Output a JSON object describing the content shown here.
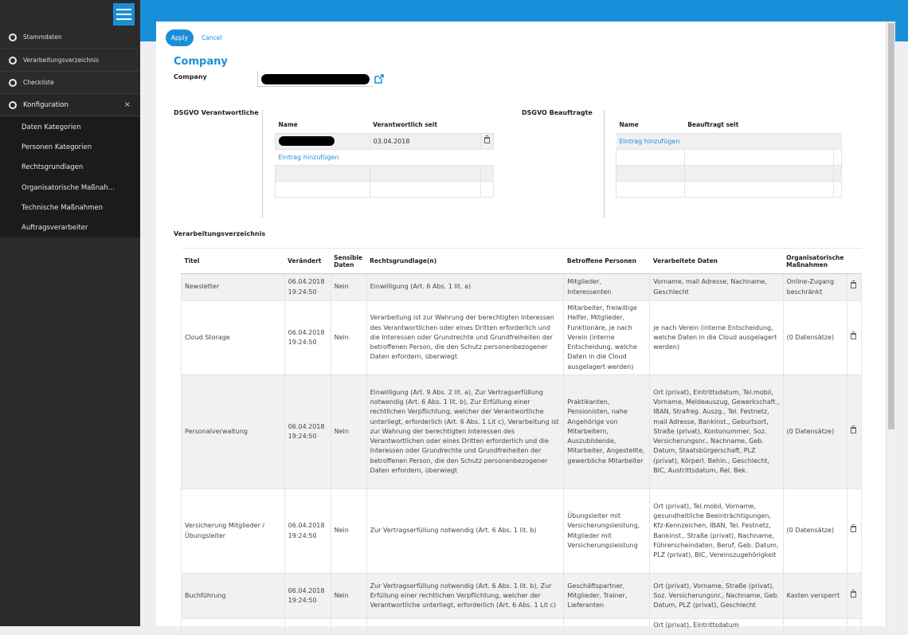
{
  "sidebar": {
    "main_items": [
      {
        "label": "Stammdaten"
      },
      {
        "label": "Verarbeitungsverzeichnis"
      },
      {
        "label": "Checkliste"
      },
      {
        "label": "Konfiguration",
        "close_symbol": "×"
      }
    ],
    "sub_items": [
      {
        "label": "Daten Kategorien"
      },
      {
        "label": "Personen Kategorien"
      },
      {
        "label": "Rechtsgrundlagen"
      },
      {
        "label": "Organisatorische Maßnah..."
      },
      {
        "label": "Technische Maßnahmen"
      },
      {
        "label": "Auftragsverarbeiter"
      }
    ]
  },
  "toolbar": {
    "apply_label": "Apply",
    "cancel_label": "Cancel"
  },
  "company": {
    "heading": "Company",
    "field_label": "Company"
  },
  "verantwortliche": {
    "section_label": "DSGVO Verantwortliche",
    "col_name": "Name",
    "col_since": "Verantwortlich seit",
    "rows": [
      {
        "since": "03.04.2018"
      }
    ],
    "add_link": "Eintrag hinzufügen"
  },
  "beauftragte": {
    "section_label": "DSGVO Beauftragte",
    "col_name": "Name",
    "col_since": "Beauftragt seit",
    "add_link": "Eintrag hinzufügen"
  },
  "verzeichnis": {
    "section_label": "Verarbeitungsverzeichnis",
    "headers": {
      "titel": "Titel",
      "veraendert": "Verändert",
      "sensible": "Sensible Daten",
      "rechtsgrundlage": "Rechtsgrundlage(n)",
      "personen": "Betroffene Personen",
      "daten": "Verarbeitete Daten",
      "massnahmen": "Organisatorische Maßnahmen"
    },
    "rows": [
      {
        "titel": "Newsletter",
        "veraendert": "06.04.2018 19:24:50",
        "sensible": "Nein",
        "rechtsgrundlage": "Einwilligung (Art. 6 Abs. 1 lit. a)",
        "personen": "Mitglieder, Interessenten",
        "daten": "Vorname, mail Adresse, Nachname, Geschlecht",
        "massnahmen": "Online-Zugang beschränkt"
      },
      {
        "titel": "Cloud Storage",
        "veraendert": "06.04.2018 19:24:50",
        "sensible": "Nein",
        "rechtsgrundlage": "Verarbeitung ist zur Wahrung der berechtigten Interessen des Verantwortlichen oder eines Dritten erforderlich und die Interessen oder Grundrechte und Grundfreiheiten der betroffenen Person, die den Schutz personenbezogener Daten erfordern, überwiegt",
        "personen": "Mitarbeiter, freiwillige Helfer, Mitglieder, Funktionäre, je nach Verein (interne Entscheidung, welche Daten in die Cloud ausgelagert werden)",
        "daten": "je nach Verein (interne Entscheidung, welche Daten in die Cloud ausgelagert werden)",
        "massnahmen": "(0 Datensätze)"
      },
      {
        "titel": "Personalverwaltung",
        "veraendert": "06.04.2018 19:24:50",
        "sensible": "Nein",
        "rechtsgrundlage": "Einwilligung (Art. 9 Abs. 2 lit. a), Zur Vertragserfüllung notwendig (Art. 6 Abs. 1 lit. b), Zur Erfüllung einer rechtlichen Verpflichtung, welcher der Verantwortliche unterliegt, erforderlich (Art. 6 Abs. 1 Lit c), Verarbeitung ist zur Wahrung der berechtigten Interessen des Verantwortlichen oder eines Dritten erforderlich und die Interessen oder Grundrechte und Grundfreiheiten der betroffenen Person, die den Schutz personenbezogener Daten erfordern, überwiegt",
        "personen": "Praktikanten, Pensionisten, nahe Angehörige von Mitarbeitern, Auszubildende, Mitarbeiter, Angestellte, gewerbliche Mitarbeiter",
        "daten": "Ort (privat), Eintrittsdatum, Tel.mobil, Vorname, Meldeauszug, Gewerkschaft., IBAN, Strafreg. Auszg., Tel. Festnetz, mail Adresse, Bankinst., Geburtsort, Straße (privat), Kontonummer, Soz. Versicherungsnr., Nachname, Geb. Datum, Staatsbürgerschaft, PLZ (privat), Körperl. Behin., Geschlecht, BIC, Austrittsdatum, Rel. Bek.",
        "massnahmen": "(0 Datensätze)"
      },
      {
        "titel": "Versicherung Mitglieder / Übungsleiter",
        "veraendert": "06.04.2018 19:24:50",
        "sensible": "Nein",
        "rechtsgrundlage": "Zur Vertragserfüllung notwendig (Art. 6 Abs. 1 lit. b)",
        "personen": "Übungsleiter mit Versicherungsleistung, Mitglieder mit Versicherungsleistung",
        "daten": "Ort (privat), Tel.mobil, Vorname, gesundheitliche Beeinträchtigungen, Kfz-Kennzeichen, IBAN, Tel. Festnetz, Bankinst., Straße (privat), Nachname, Führerscheindaten, Beruf, Geb. Datum, PLZ (privat), BIC, Vereinszugehörigkeit",
        "massnahmen": "(0 Datensätze)"
      },
      {
        "titel": "Buchführung",
        "veraendert": "06.04.2018 19:24:50",
        "sensible": "Nein",
        "rechtsgrundlage": "Zur Vertragserfüllung notwendig (Art. 6 Abs. 1 lit. b), Zur Erfüllung einer rechtlichen Verpflichtung, welcher der Verantwortliche unterliegt, erforderlich (Art. 6 Abs. 1 Lit c)",
        "personen": "Geschäftspartner, Mitglieder, Trainer, Lieferanten",
        "daten": "Ort (privat), Vorname, Straße (privat), Soz. Versicherungsnr., Nachname, Geb. Datum, PLZ (privat), Geschlecht",
        "massnahmen": "Kasten versperrt"
      }
    ],
    "partial_row": {
      "daten": "Ort (privat), Eintrittsdatum"
    }
  }
}
